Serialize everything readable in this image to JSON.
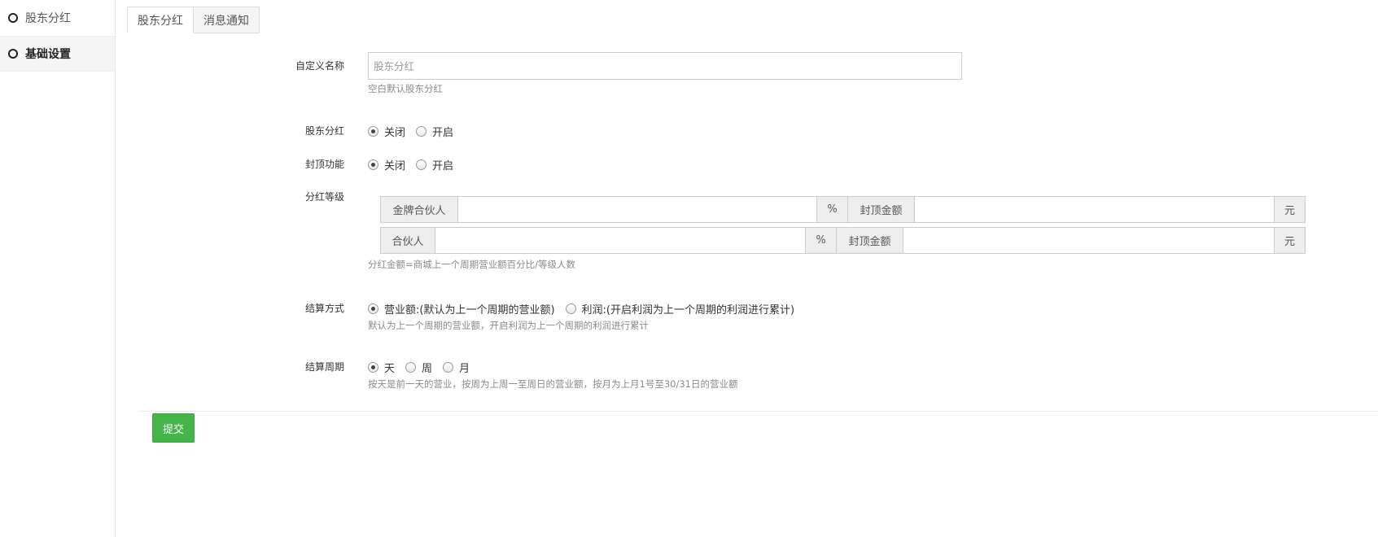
{
  "sidebar": {
    "items": [
      {
        "label": "股东分红",
        "icon": "circle-icon"
      },
      {
        "label": "基础设置",
        "icon": "circle-icon",
        "active": true
      }
    ]
  },
  "tabs": [
    {
      "label": "股东分红",
      "active": true
    },
    {
      "label": "消息通知"
    }
  ],
  "form": {
    "custom_name": {
      "label": "自定义名称",
      "placeholder": "股东分红",
      "value": "",
      "help": "空白默认股东分红"
    },
    "dividend": {
      "label": "股东分红",
      "options": [
        "关闭",
        "开启"
      ],
      "selected": "关闭"
    },
    "cap_feature": {
      "label": "封顶功能",
      "options": [
        "关闭",
        "开启"
      ],
      "selected": "关闭"
    },
    "levels": {
      "label": "分红等级",
      "rows": [
        {
          "name": "金牌合伙人",
          "percent_unit": "%",
          "cap_label": "封顶金额",
          "cap_unit": "元",
          "percent": "",
          "cap": ""
        },
        {
          "name": "合伙人",
          "percent_unit": "%",
          "cap_label": "封顶金额",
          "cap_unit": "元",
          "percent": "",
          "cap": ""
        }
      ],
      "help": "分红金额=商城上一个周期营业额百分比/等级人数"
    },
    "settle_method": {
      "label": "结算方式",
      "options": [
        "营业额:(默认为上一个周期的营业额)",
        "利润:(开启利润为上一个周期的利润进行累计)"
      ],
      "selected": "营业额:(默认为上一个周期的营业额)",
      "help": "默认为上一个周期的营业额，开启利润为上一个周期的利润进行累计"
    },
    "settle_period": {
      "label": "结算周期",
      "options": [
        "天",
        "周",
        "月"
      ],
      "selected": "天",
      "help": "按天是前一天的营业，按周为上周一至周日的营业额，按月为上月1号至30/31日的营业额"
    },
    "submit_label": "提交"
  },
  "colors": {
    "submit_bg": "#44b549",
    "help_text": "#8a8a8a"
  }
}
